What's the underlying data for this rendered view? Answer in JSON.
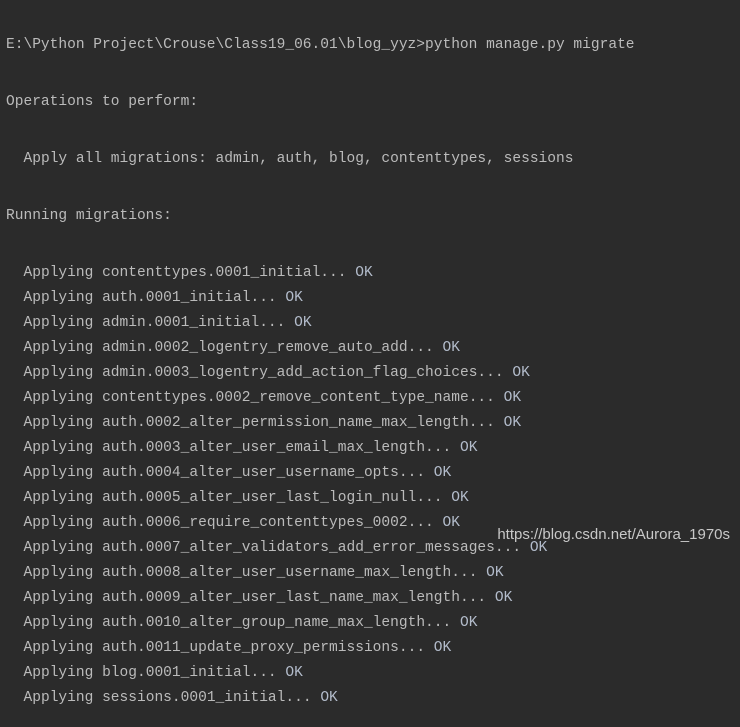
{
  "terminal": {
    "command_line": "E:\\Python Project\\Crouse\\Class19_06.01\\blog_yyz>python manage.py migrate",
    "operations_header": "Operations to perform:",
    "apply_all": "Apply all migrations: admin, auth, blog, contenttypes, sessions",
    "running_header": "Running migrations:",
    "migrations": [
      {
        "text": "Applying contenttypes.0001_initial... ",
        "status": "OK"
      },
      {
        "text": "Applying auth.0001_initial... ",
        "status": "OK"
      },
      {
        "text": "Applying admin.0001_initial... ",
        "status": "OK"
      },
      {
        "text": "Applying admin.0002_logentry_remove_auto_add... ",
        "status": "OK"
      },
      {
        "text": "Applying admin.0003_logentry_add_action_flag_choices... ",
        "status": "OK"
      },
      {
        "text": "Applying contenttypes.0002_remove_content_type_name... ",
        "status": "OK"
      },
      {
        "text": "Applying auth.0002_alter_permission_name_max_length... ",
        "status": "OK"
      },
      {
        "text": "Applying auth.0003_alter_user_email_max_length... ",
        "status": "OK"
      },
      {
        "text": "Applying auth.0004_alter_user_username_opts... ",
        "status": "OK"
      },
      {
        "text": "Applying auth.0005_alter_user_last_login_null... ",
        "status": "OK"
      },
      {
        "text": "Applying auth.0006_require_contenttypes_0002... ",
        "status": "OK"
      },
      {
        "text": "Applying auth.0007_alter_validators_add_error_messages... ",
        "status": "OK"
      },
      {
        "text": "Applying auth.0008_alter_user_username_max_length... ",
        "status": "OK"
      },
      {
        "text": "Applying auth.0009_alter_user_last_name_max_length... ",
        "status": "OK"
      },
      {
        "text": "Applying auth.0010_alter_group_name_max_length... ",
        "status": "OK"
      },
      {
        "text": "Applying auth.0011_update_proxy_permissions... ",
        "status": "OK"
      },
      {
        "text": "Applying blog.0001_initial... ",
        "status": "OK"
      },
      {
        "text": "Applying sessions.0001_initial... ",
        "status": "OK"
      }
    ]
  },
  "watermark": "https://blog.csdn.net/Aurora_1970s",
  "colors": {
    "background": "#2b2b2b",
    "text": "#bbbbbb"
  }
}
